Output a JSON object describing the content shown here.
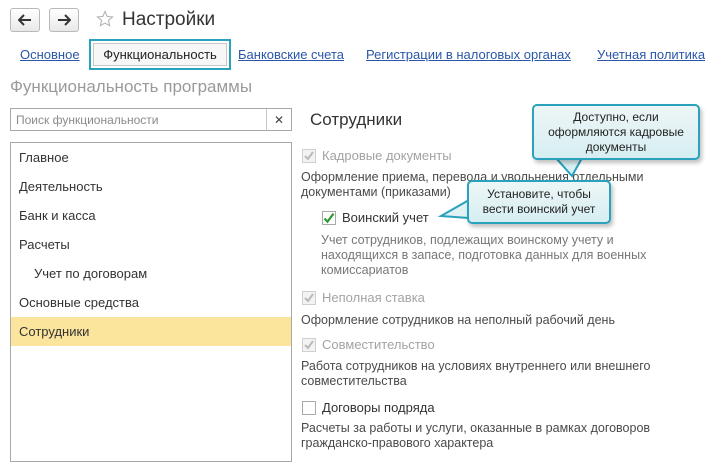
{
  "window": {
    "title": "Настройки"
  },
  "tabs": [
    {
      "label": "Основное"
    },
    {
      "label": "Функциональность"
    },
    {
      "label": "Банковские счета"
    },
    {
      "label": "Регистрации в налоговых органах"
    },
    {
      "label": "Учетная политика"
    }
  ],
  "active_tab": "Функциональность",
  "section_title": "Функциональность программы",
  "search": {
    "placeholder": "Поиск функциональности",
    "value": ""
  },
  "sidebar": {
    "items": [
      {
        "label": "Главное"
      },
      {
        "label": "Деятельность"
      },
      {
        "label": "Банк и касса"
      },
      {
        "label": "Расчеты"
      },
      {
        "label": "Учет по договорам"
      },
      {
        "label": "Основные средства"
      },
      {
        "label": "Сотрудники"
      }
    ],
    "selected": "Сотрудники"
  },
  "main": {
    "title": "Сотрудники",
    "options": [
      {
        "label": "Кадровые документы",
        "checked": true,
        "enabled": false,
        "description": "Оформление приема, перевода и увольнения отдельными документами (приказами)"
      },
      {
        "label": "Воинский учет",
        "checked": true,
        "enabled": true,
        "description": "Учет сотрудников, подлежащих воинскому учету и находящихся в запасе, подготовка данных для военных комиссариатов"
      },
      {
        "label": "Неполная ставка",
        "checked": true,
        "enabled": false,
        "description": "Оформление сотрудников на неполный рабочий день"
      },
      {
        "label": "Совместительство",
        "checked": true,
        "enabled": false,
        "description": "Работа сотрудников на условиях внутреннего или внешнего совместительства"
      },
      {
        "label": "Договоры подряда",
        "checked": false,
        "enabled": true,
        "description": "Расчеты за работы и услуги, оказанные в рамках договоров гражданско-правового характера"
      }
    ]
  },
  "callouts": [
    {
      "text": "Доступно, если оформляются кадровые документы"
    },
    {
      "text": "Установите, чтобы вести воинский учет"
    }
  ],
  "colors": {
    "accent": "#2aa1bd",
    "selected_row": "#fbe49b",
    "link": "#2b57a8",
    "check": "#2e9a2e"
  }
}
